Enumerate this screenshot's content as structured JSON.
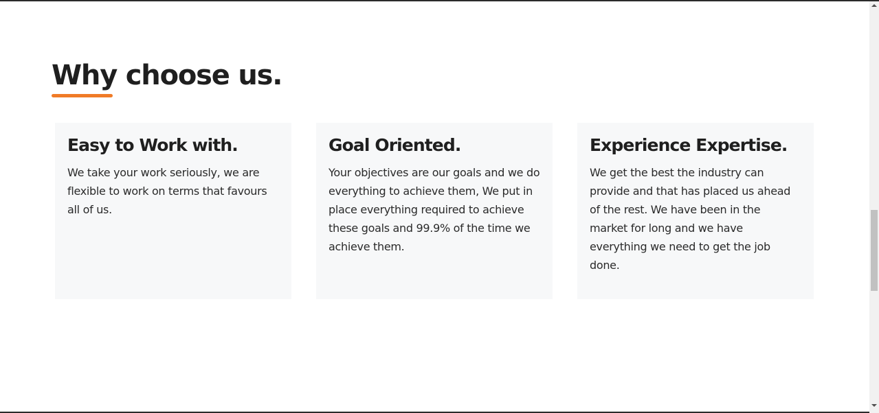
{
  "section": {
    "title": "Why choose us.",
    "accent_color": "#f07b27"
  },
  "features": [
    {
      "title": "Easy to Work with.",
      "text": "We take your work seriously, we are flexible to work on terms that favours all of us."
    },
    {
      "title": "Goal Oriented.",
      "text": "Your objectives are our goals and we do everything to achieve them, We put in place everything required to achieve these goals and 99.9% of the time we achieve them."
    },
    {
      "title": "Experience Expertise.",
      "text": "We get the best the industry can provide and that has placed us ahead of the rest. We have been in the market for long and we have everything we need to get the job done."
    }
  ],
  "colors": {
    "card_background": "#f7f8f9",
    "heading_text": "#1f1f1f",
    "body_text": "#2a2a2a"
  }
}
